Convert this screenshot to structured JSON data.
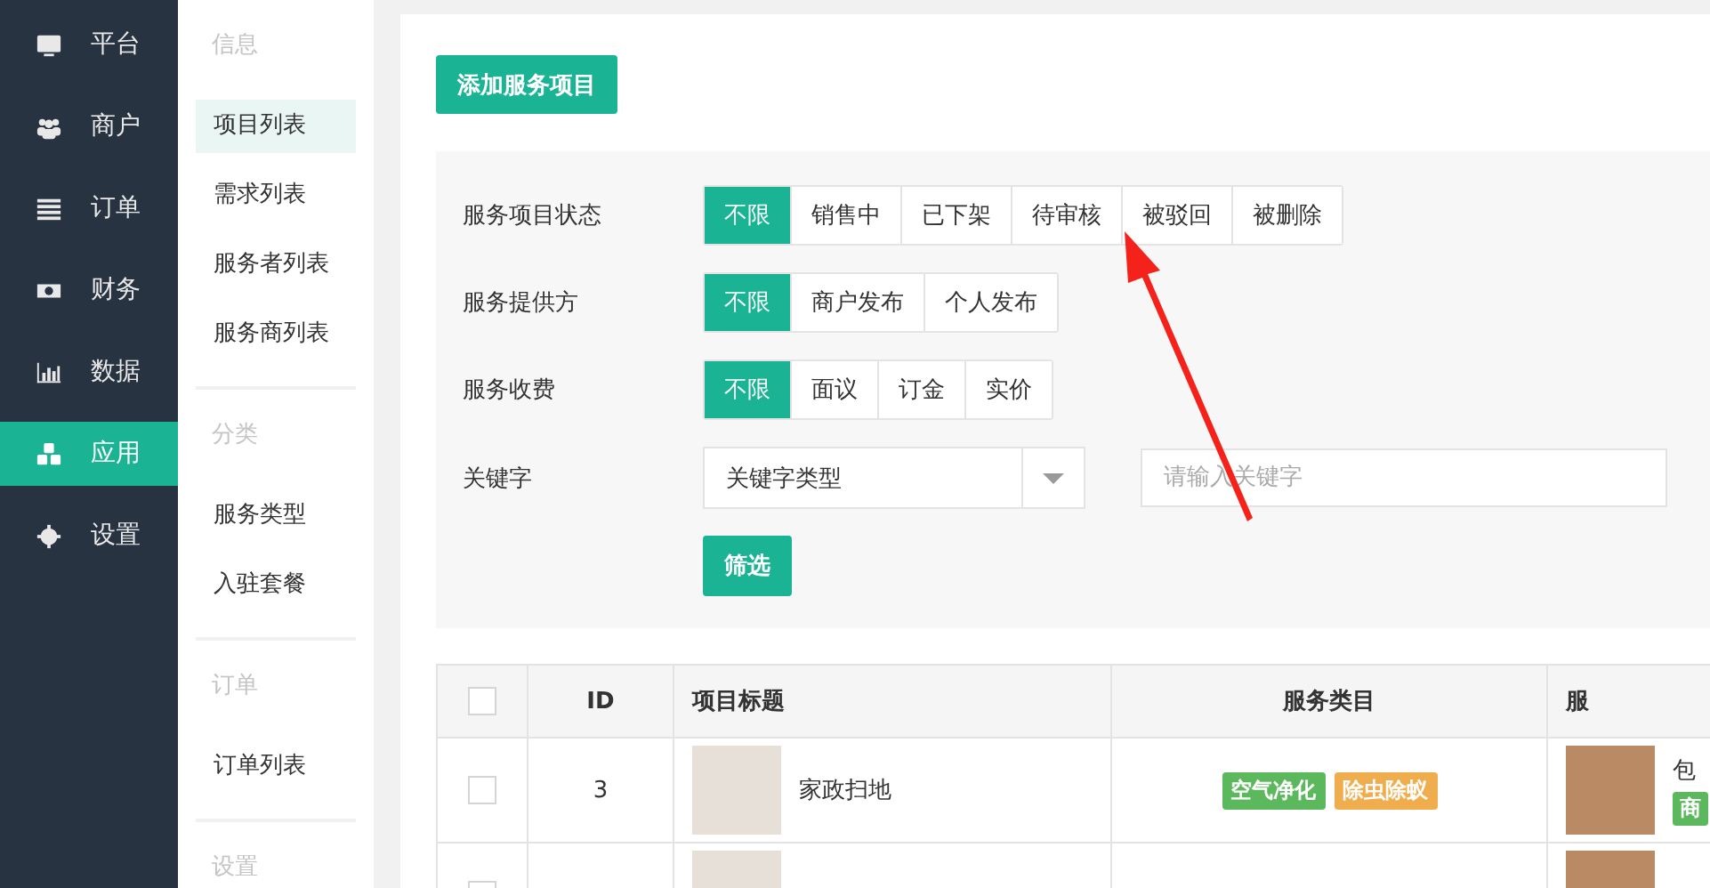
{
  "nav": [
    {
      "label": "平台",
      "selected": false
    },
    {
      "label": "商户",
      "selected": false
    },
    {
      "label": "订单",
      "selected": false
    },
    {
      "label": "财务",
      "selected": false
    },
    {
      "label": "数据",
      "selected": false
    },
    {
      "label": "应用",
      "selected": true
    },
    {
      "label": "设置",
      "selected": false
    }
  ],
  "subnav": [
    {
      "title": "信息",
      "items": [
        {
          "label": "项目列表",
          "selected": true
        },
        {
          "label": "需求列表",
          "selected": false
        },
        {
          "label": "服务者列表",
          "selected": false
        },
        {
          "label": "服务商列表",
          "selected": false
        }
      ]
    },
    {
      "title": "分类",
      "items": [
        {
          "label": "服务类型",
          "selected": false
        },
        {
          "label": "入驻套餐",
          "selected": false
        }
      ]
    },
    {
      "title": "订单",
      "items": [
        {
          "label": "订单列表",
          "selected": false
        }
      ]
    },
    {
      "title": "设置"
    }
  ],
  "add_button": "添加服务项目",
  "filters": [
    {
      "label": "服务项目状态",
      "options": [
        {
          "label": "不限",
          "selected": true
        },
        {
          "label": "销售中",
          "selected": false
        },
        {
          "label": "已下架",
          "selected": false
        },
        {
          "label": "待审核",
          "selected": false
        },
        {
          "label": "被驳回",
          "selected": false
        },
        {
          "label": "被删除",
          "selected": false
        }
      ]
    },
    {
      "label": "服务提供方",
      "options": [
        {
          "label": "不限",
          "selected": true
        },
        {
          "label": "商户发布",
          "selected": false
        },
        {
          "label": "个人发布",
          "selected": false
        }
      ]
    },
    {
      "label": "服务收费",
      "options": [
        {
          "label": "不限",
          "selected": true
        },
        {
          "label": "面议",
          "selected": false
        },
        {
          "label": "订金",
          "selected": false
        },
        {
          "label": "实价",
          "selected": false
        }
      ]
    }
  ],
  "keyword": {
    "label": "关键字",
    "select_value": "关键字类型",
    "placeholder": "请输入关键字"
  },
  "filter_button": "筛选",
  "table": {
    "select_all_checked": false,
    "columns": [
      "ID",
      "项目标题",
      "服务类目",
      "服"
    ],
    "rows": [
      {
        "checked": false,
        "id": "3",
        "title": "家政扫地",
        "categories": [
          {
            "label": "空气净化",
            "color": "#5cb85c"
          },
          {
            "label": "除虫除蚁",
            "color": "#f0ad4e"
          }
        ],
        "provider": {
          "name": "包",
          "tag": "商"
        }
      },
      {
        "checked": false
      }
    ]
  }
}
